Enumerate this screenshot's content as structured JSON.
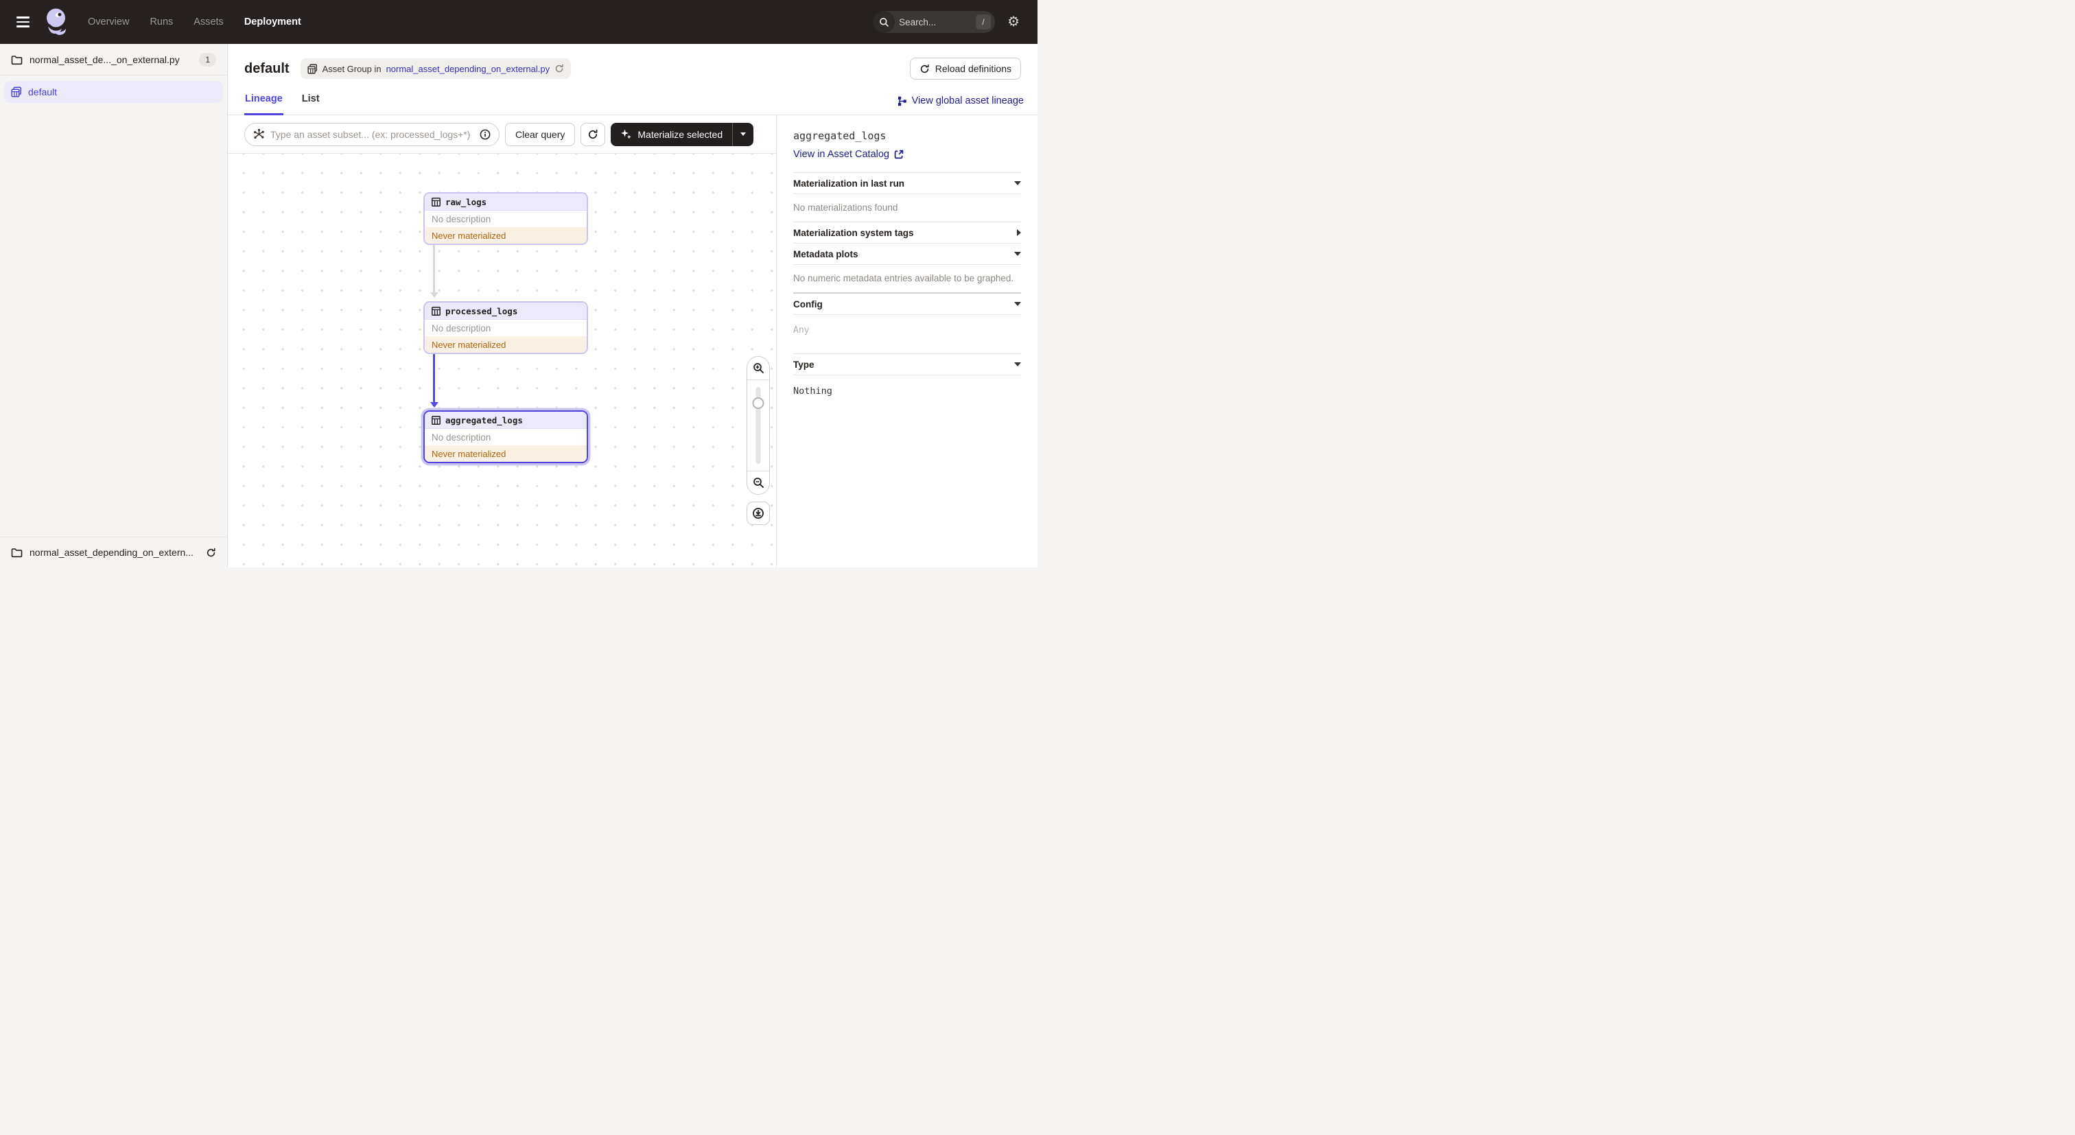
{
  "nav": {
    "items": [
      {
        "label": "Overview",
        "active": false
      },
      {
        "label": "Runs",
        "active": false
      },
      {
        "label": "Assets",
        "active": false
      },
      {
        "label": "Deployment",
        "active": true
      }
    ],
    "search": {
      "placeholder": "Search...",
      "shortcut": "/"
    }
  },
  "sidebar": {
    "repo": {
      "label": "normal_asset_de..._on_external.py",
      "badge": "1"
    },
    "group": {
      "label": "default"
    },
    "footer": {
      "label": "normal_asset_depending_on_extern..."
    }
  },
  "header": {
    "title": "default",
    "breadcrumb": {
      "prefix": "Asset Group in",
      "link": "normal_asset_depending_on_external.py"
    },
    "reload_label": "Reload definitions"
  },
  "tabs": {
    "lineage": "Lineage",
    "list": "List",
    "global_link": "View global asset lineage"
  },
  "toolbar": {
    "query_placeholder": "Type an asset subset... (ex: processed_logs+*)",
    "clear_label": "Clear query",
    "materialize_label": "Materialize selected"
  },
  "graph": {
    "nodes": [
      {
        "name": "raw_logs",
        "description": "No description",
        "status": "Never materialized",
        "selected": false
      },
      {
        "name": "processed_logs",
        "description": "No description",
        "status": "Never materialized",
        "selected": false
      },
      {
        "name": "aggregated_logs",
        "description": "No description",
        "status": "Never materialized",
        "selected": true
      }
    ]
  },
  "panel": {
    "title": "aggregated_logs",
    "catalog_link": "View in Asset Catalog",
    "s1_header": "Materialization in last run",
    "s1_empty": "No materializations found",
    "s2_header": "Materialization system tags",
    "s3_header": "Metadata plots",
    "s3_empty": "No numeric metadata entries available to be graphed.",
    "s4_header": "Config",
    "s4_value": "Any",
    "s5_header": "Type",
    "s5_value": "Nothing"
  },
  "colors": {
    "accent": "#4F43DD",
    "link_dark": "#1E1B8F",
    "nav_bg": "#262120",
    "status_text": "#B0630D",
    "status_bg": "#FAF1E4",
    "node_border": "#C9C5F0",
    "node_header_bg": "#EBE9FA",
    "arrow_gray": "#DAD7D4",
    "arrow_active": "#5348E1",
    "selected_row_bg": "#EDEBFA"
  }
}
